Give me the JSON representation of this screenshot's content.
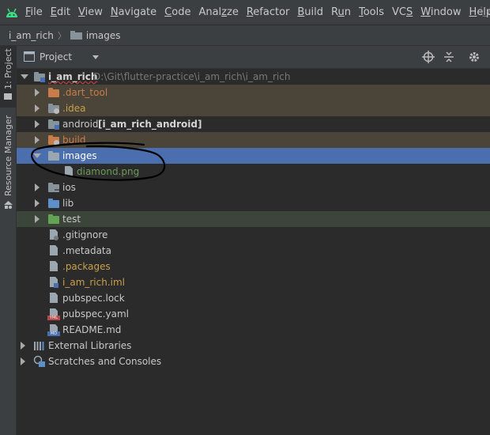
{
  "menu": {
    "items": [
      {
        "label": "File",
        "mnemonic": "F"
      },
      {
        "label": "Edit",
        "mnemonic": "E"
      },
      {
        "label": "View",
        "mnemonic": "V"
      },
      {
        "label": "Navigate",
        "mnemonic": "N"
      },
      {
        "label": "Code",
        "mnemonic": "C"
      },
      {
        "label": "Analyze",
        "mnemonic": "z"
      },
      {
        "label": "Refactor",
        "mnemonic": "R"
      },
      {
        "label": "Build",
        "mnemonic": "B"
      },
      {
        "label": "Run",
        "mnemonic": "u"
      },
      {
        "label": "Tools",
        "mnemonic": "T"
      },
      {
        "label": "VCS",
        "mnemonic": "S"
      },
      {
        "label": "Window",
        "mnemonic": "W"
      },
      {
        "label": "Help",
        "mnemonic": "H"
      }
    ],
    "window_title_fragment": "i_a"
  },
  "breadcrumb": {
    "project": "i_am_rich",
    "folder": "images"
  },
  "side_tabs": {
    "project": "1: Project",
    "resource_manager": "Resource Manager"
  },
  "panel": {
    "title": "Project"
  },
  "tree": {
    "root": {
      "name": "i_am_rich",
      "path": "D:\\Git\\flutter-practice\\i_am_rich\\i_am_rich"
    },
    "nodes": [
      {
        "label": ".dart_tool",
        "color": "#c97b4a"
      },
      {
        "label": ".idea",
        "color": "#c9a04a"
      },
      {
        "label": "android",
        "extra": "[i_am_rich_android]",
        "color": "#c8c8c8"
      },
      {
        "label": "build",
        "color": "#c97b4a"
      },
      {
        "label": "images",
        "color": "#d4d4d4"
      },
      {
        "label": "diamond.png",
        "color": "#6a9955"
      },
      {
        "label": "ios",
        "color": "#c8c8c8"
      },
      {
        "label": "lib",
        "color": "#c8c8c8"
      },
      {
        "label": "test",
        "color": "#c8c8c8"
      },
      {
        "label": ".gitignore",
        "color": "#c8c8c8"
      },
      {
        "label": ".metadata",
        "color": "#c8c8c8"
      },
      {
        "label": ".packages",
        "color": "#c9a04a"
      },
      {
        "label": "i_am_rich.iml",
        "color": "#c9a04a"
      },
      {
        "label": "pubspec.lock",
        "color": "#c8c8c8"
      },
      {
        "label": "pubspec.yaml",
        "color": "#c8c8c8"
      },
      {
        "label": "README.md",
        "color": "#c8c8c8"
      },
      {
        "label": "External Libraries",
        "color": "#c8c8c8"
      },
      {
        "label": "Scratches and Consoles",
        "color": "#c8c8c8"
      }
    ]
  },
  "colors": {
    "selection": "#4b6eaf",
    "excluded_bg": "#4b4539",
    "test_bg": "#3b4539",
    "accent_green": "#6a9955"
  }
}
